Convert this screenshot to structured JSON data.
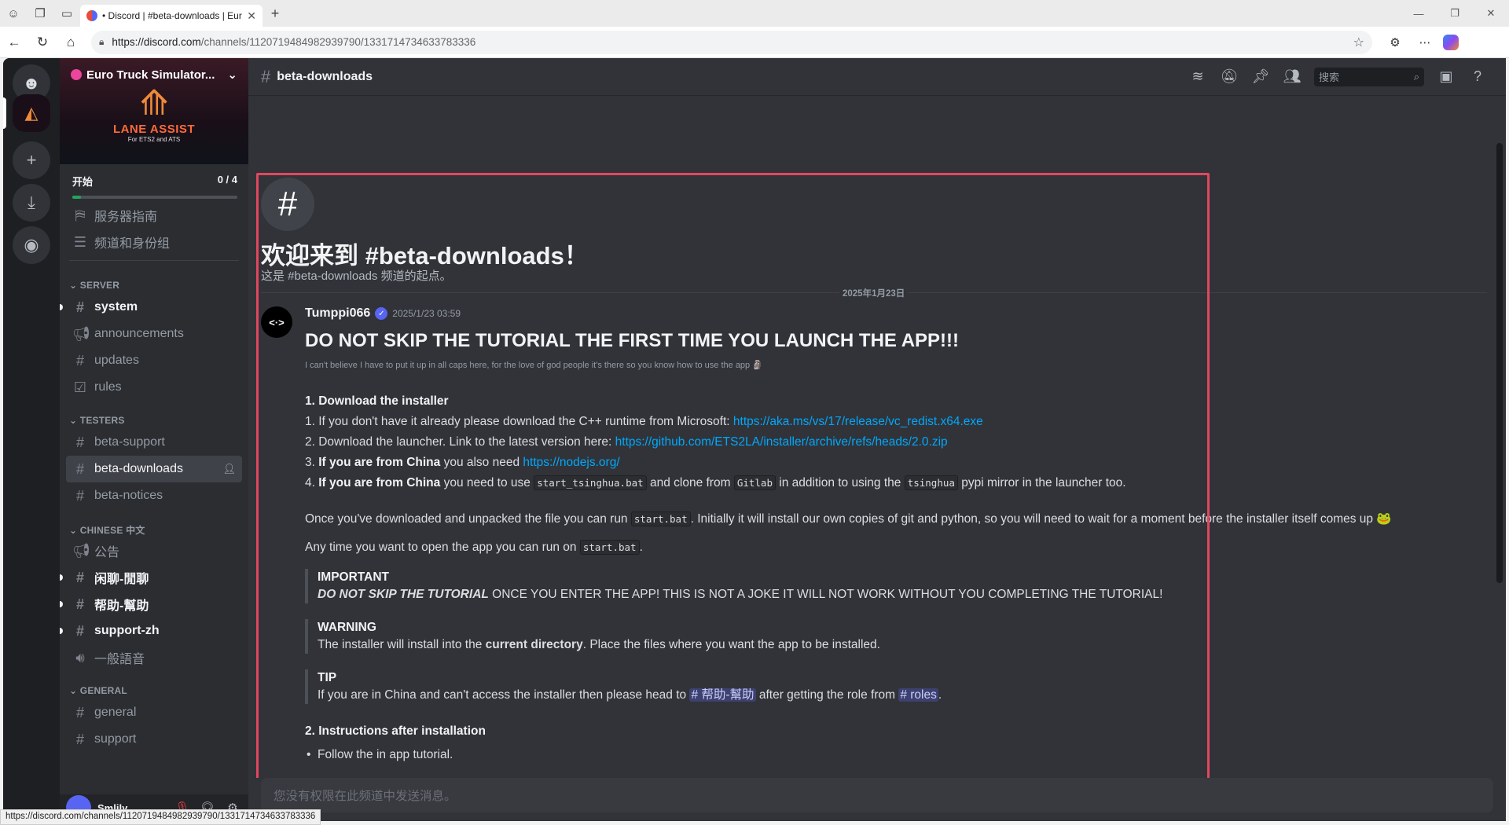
{
  "browser": {
    "tab_title": "• Discord | #beta-downloads | Eur",
    "url_host": "https://discord.com",
    "url_path": "/channels/1120719484982939790/1331714734633783336"
  },
  "server": {
    "name": "Euro Truck Simulator...",
    "banner_title": "LANE ASSIST",
    "banner_sub": "For ETS2 and ATS",
    "progress_label": "开始",
    "progress_count": "0 / 4",
    "progress_fraction": 0.05
  },
  "sidebar": {
    "top_items": [
      {
        "label": "服务器指南",
        "icon": "signpost-icon"
      },
      {
        "label": "频道和身份组",
        "icon": "list-icon"
      }
    ],
    "categories": [
      {
        "name": "SERVER",
        "channels": [
          {
            "label": "system",
            "icon": "#",
            "unread": true
          },
          {
            "label": "announcements",
            "icon": "megaphone",
            "unread": false
          },
          {
            "label": "updates",
            "icon": "#",
            "unread": false
          },
          {
            "label": "rules",
            "icon": "check",
            "unread": false
          }
        ]
      },
      {
        "name": "TESTERS",
        "channels": [
          {
            "label": "beta-support",
            "icon": "#",
            "unread": false
          },
          {
            "label": "beta-downloads",
            "icon": "#",
            "active": true
          },
          {
            "label": "beta-notices",
            "icon": "#",
            "unread": false
          }
        ]
      },
      {
        "name": "CHINESE 中文",
        "channels": [
          {
            "label": "公告",
            "icon": "megaphone",
            "unread": false
          },
          {
            "label": "闲聊-閒聊",
            "icon": "#",
            "unread": true
          },
          {
            "label": "帮助-幫助",
            "icon": "#",
            "unread": true
          },
          {
            "label": "support-zh",
            "icon": "#",
            "unread": true
          },
          {
            "label": "一般語音",
            "icon": "speaker",
            "unread": false
          }
        ]
      },
      {
        "name": "GENERAL",
        "channels": [
          {
            "label": "general",
            "icon": "#",
            "unread": false
          },
          {
            "label": "support",
            "icon": "#",
            "unread": false
          }
        ]
      }
    ]
  },
  "user": {
    "name": "Smlily"
  },
  "header": {
    "channel": "beta-downloads",
    "search_placeholder": "搜索"
  },
  "welcome": {
    "title": "欢迎来到 #beta-downloads！",
    "subtitle": "这是 #beta-downloads 频道的起点。"
  },
  "date_divider": "2025年1月23日",
  "message": {
    "author": "Tumppi066",
    "timestamp": "2025/1/23 03:59",
    "heading": "DO NOT SKIP THE TUTORIAL THE FIRST TIME YOU LAUNCH THE APP!!!",
    "subtext": "I can't believe I have to put it up in all caps here, for the love of god people it's there so you know how to use the app",
    "section1": "1. Download the installer",
    "step1_text": "1. If you don't have it already please download the C++ runtime from Microsoft: ",
    "step1_link": "https://aka.ms/vs/17/release/vc_redist.x64.exe",
    "step2_text": "2. Download the launcher. Link to the latest version here: ",
    "step2_link": "https://github.com/ETS2LA/installer/archive/refs/heads/2.0.zip",
    "step3_prefix": "3. ",
    "step3_bold": "If you are from China",
    "step3_text": " you also need ",
    "step3_link": "https://nodejs.org/",
    "step4_prefix": "4. ",
    "step4_bold": "If you are from China",
    "step4_text1": " you need to use ",
    "step4_code1": "start_tsinghua.bat",
    "step4_text2": " and clone from ",
    "step4_code2": "Gitlab",
    "step4_text3": " in addition to using the ",
    "step4_code3": "tsinghua",
    "step4_text4": " pypi mirror in the launcher too.",
    "para1_a": "Once you've downloaded and unpacked the file you can run ",
    "para1_code": "start.bat",
    "para1_b": ". Initially it will install our own copies of git and python, so you will need to wait for a moment before the installer itself comes up",
    "para2_a": " Any time you want to open the app you can run on ",
    "para2_code": "start.bat",
    "para2_b": ".",
    "important_title": "IMPORTANT",
    "important_emph": "DO NOT SKIP THE TUTORIAL",
    "important_rest": " ONCE YOU ENTER THE APP! THIS IS NOT A JOKE IT WILL NOT WORK WITHOUT YOU COMPLETING THE TUTORIAL!",
    "warning_title": "WARNING",
    "warning_a": "The installer will install into the ",
    "warning_bold": "current directory",
    "warning_b": ". Place the files where you want the app to be installed.",
    "tip_title": "TIP",
    "tip_a": "If you are in China and can't access the installer then please head to ",
    "tip_mention1": "# 帮助-幫助",
    "tip_b": " after getting the role from ",
    "tip_mention2": "# roles",
    "tip_c": ".",
    "section2": "2. Instructions after installation",
    "bullet1": "Follow the in app tutorial."
  },
  "input_placeholder": "您没有权限在此频道中发送消息。",
  "status_url": "https://discord.com/channels/1120719484982939790/1331714734633783336"
}
